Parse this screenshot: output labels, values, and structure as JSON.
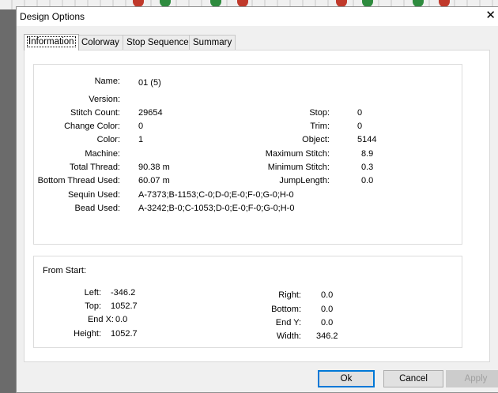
{
  "window": {
    "title": "Design Options",
    "close_glyph": "✕"
  },
  "tabs": [
    {
      "label": "Information",
      "active": true
    },
    {
      "label": "Colorway",
      "active": false
    },
    {
      "label": "Stop Sequence",
      "active": false
    },
    {
      "label": "Summary",
      "active": false
    }
  ],
  "info": {
    "name_label": "Name:",
    "name_value": "01 (5)",
    "version_label": "Version:",
    "version_value": "",
    "stitch_count_label": "Stitch Count:",
    "stitch_count_value": "29654",
    "change_color_label": "Change Color:",
    "change_color_value": "0",
    "color_label": "Color:",
    "color_value": "1",
    "machine_label": "Machine:",
    "machine_value": "",
    "total_thread_label": "Total Thread:",
    "total_thread_value": "90.38 m",
    "bottom_thread_label": "Bottom Thread Used:",
    "bottom_thread_value": "60.07 m",
    "sequin_label": "Sequin Used:",
    "sequin_value": "A-7373;B-1153;C-0;D-0;E-0;F-0;G-0;H-0",
    "bead_label": "Bead Used:",
    "bead_value": "A-3242;B-0;C-1053;D-0;E-0;F-0;G-0;H-0",
    "stop_label": "Stop:",
    "stop_value": "0",
    "trim_label": "Trim:",
    "trim_value": "0",
    "object_label": "Object:",
    "object_value": "5144",
    "max_stitch_label": "Maximum Stitch:",
    "max_stitch_value": "8.9",
    "min_stitch_label": "Minimum Stitch:",
    "min_stitch_value": "0.3",
    "jump_label": "JumpLength:",
    "jump_value": "0.0"
  },
  "from_start": {
    "heading": "From Start:",
    "left_label": "Left:",
    "left_value": "-346.2",
    "top_label": "Top:",
    "top_value": "1052.7",
    "endx_label": "End X:",
    "endx_value": "0.0",
    "height_label": "Height:",
    "height_value": "1052.7",
    "right_label": "Right:",
    "right_value": "0.0",
    "bottom_label": "Bottom:",
    "bottom_value": "0.0",
    "endy_label": "End Y:",
    "endy_value": "0.0",
    "width_label": "Width:",
    "width_value": "346.2"
  },
  "buttons": {
    "ok": "Ok",
    "cancel": "Cancel",
    "apply": "Apply"
  },
  "colors": {
    "accent": "#0078d7",
    "disabled_text": "#a0a0a0",
    "background_dots": [
      "#c0392b",
      "#2e8b3e"
    ]
  }
}
